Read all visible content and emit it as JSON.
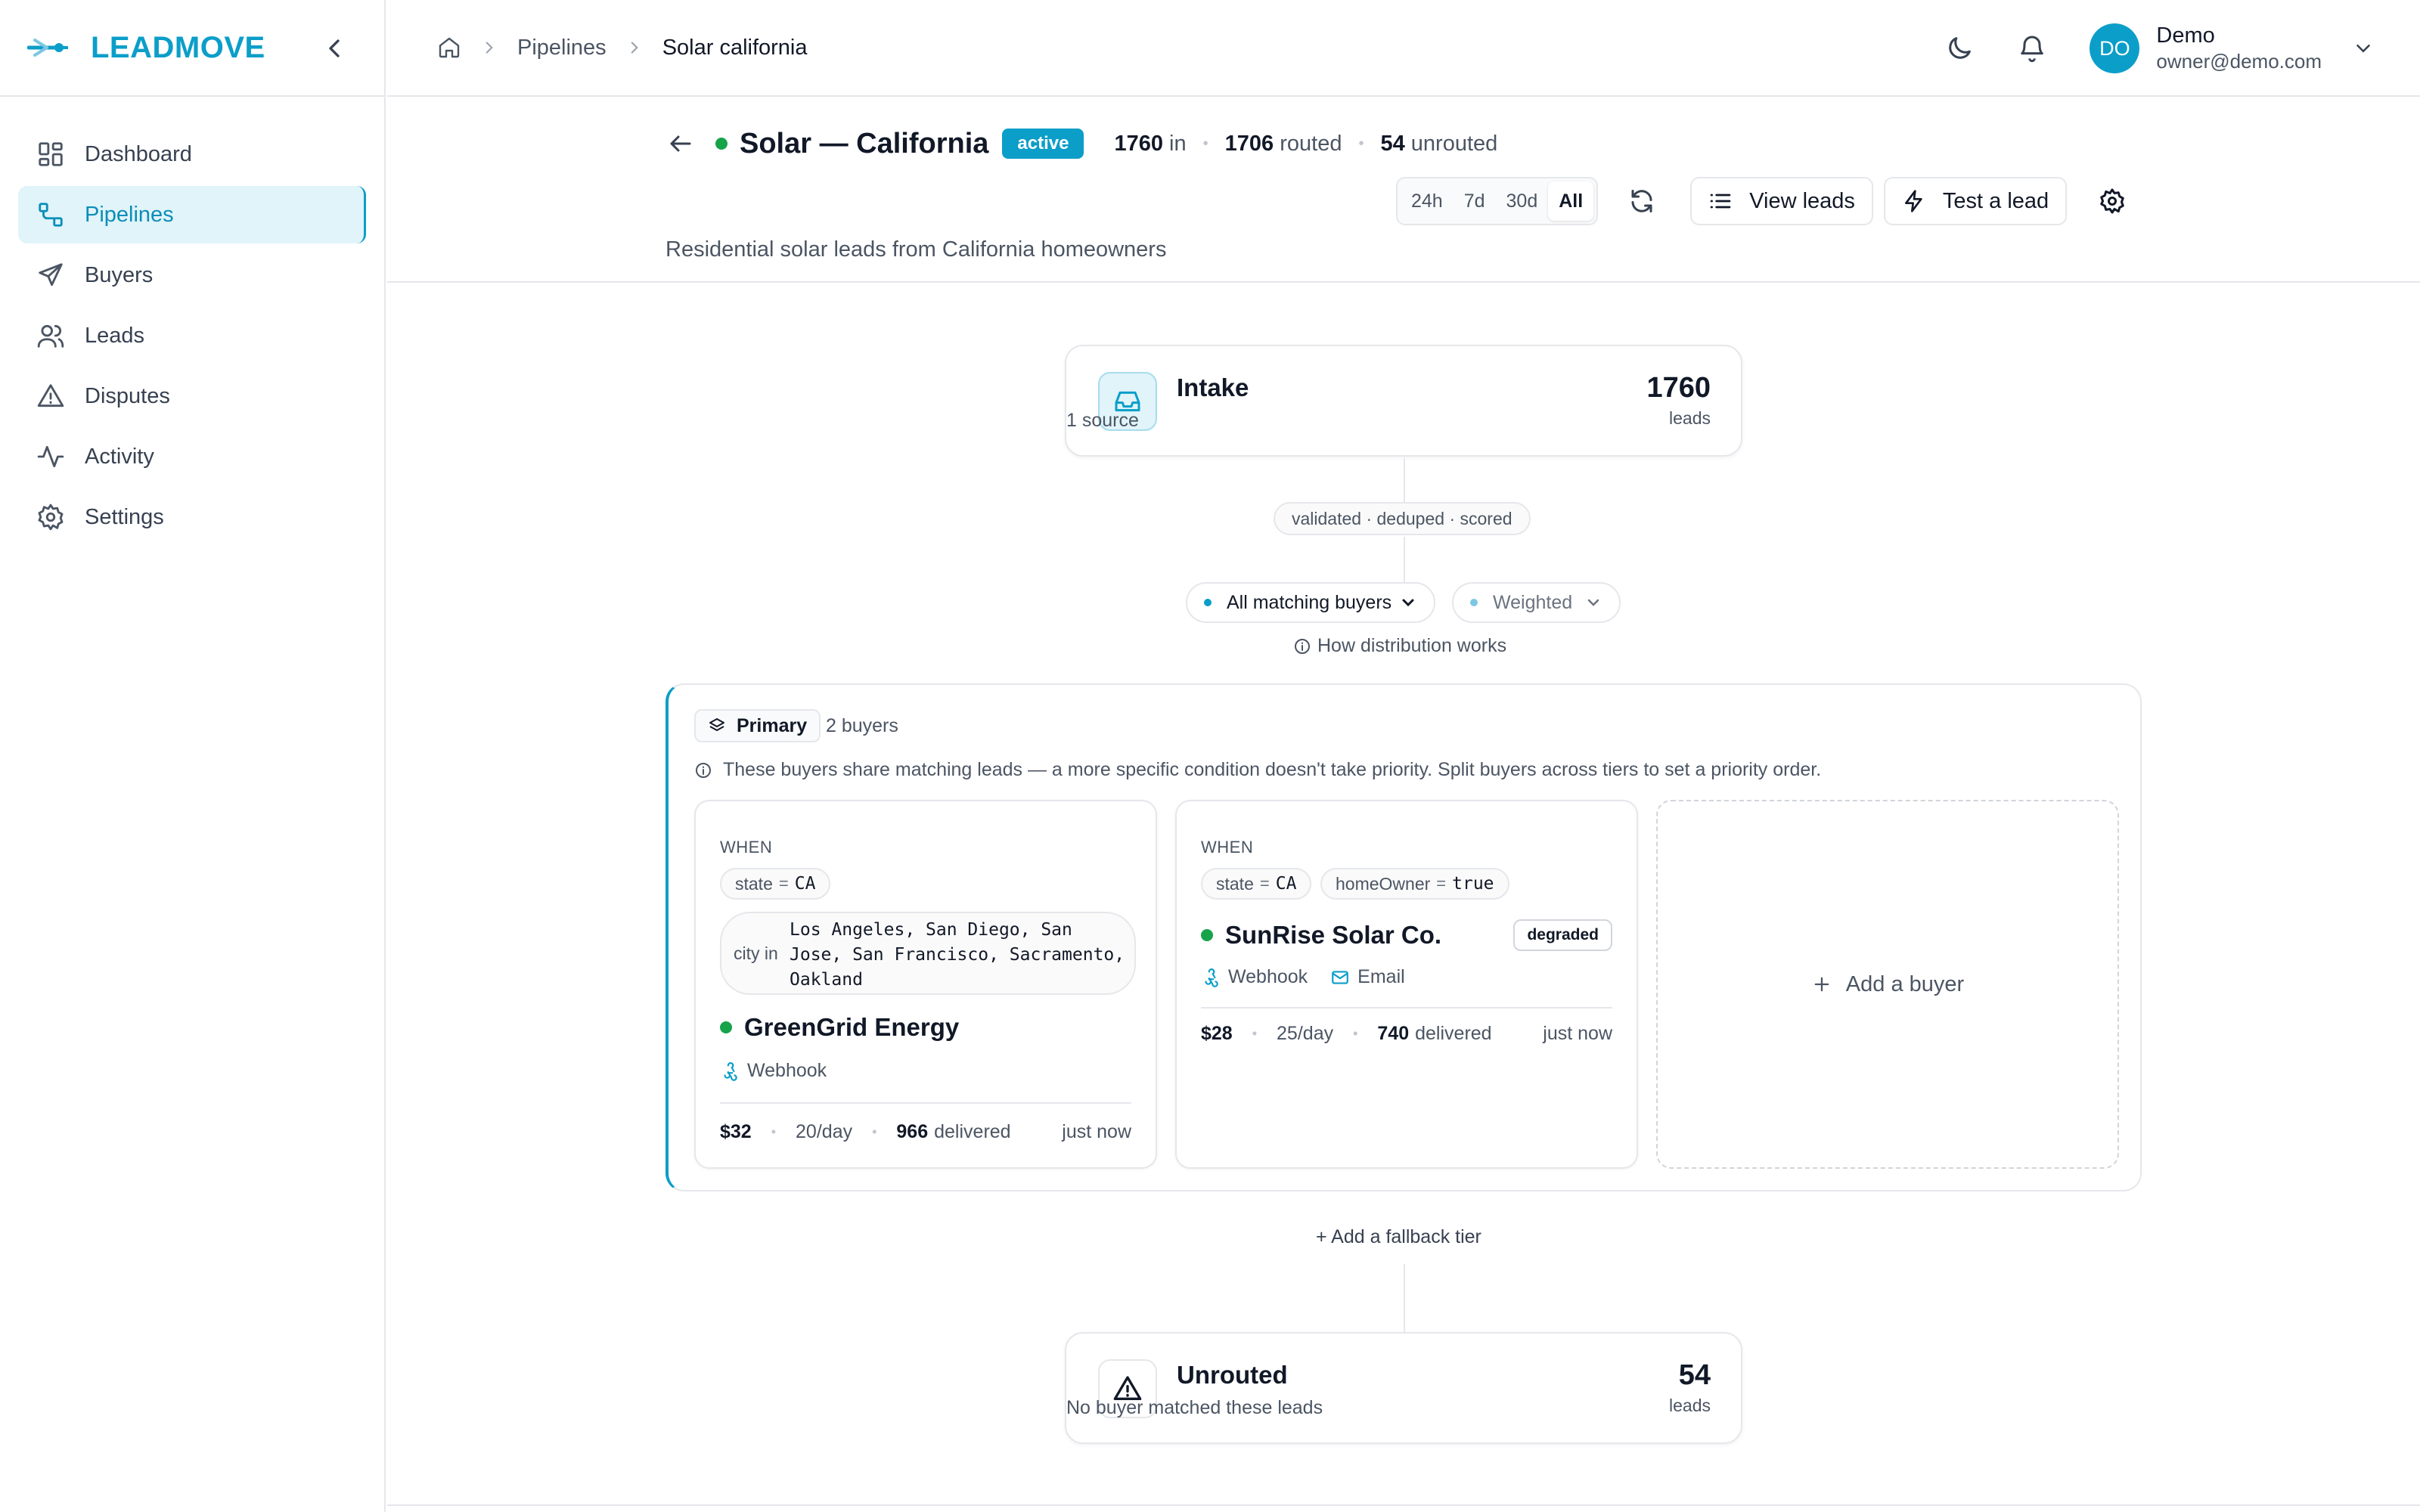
{
  "brand": {
    "name": "LEADMOVE"
  },
  "sidebar": {
    "items": [
      {
        "label": "Dashboard"
      },
      {
        "label": "Pipelines"
      },
      {
        "label": "Buyers"
      },
      {
        "label": "Leads"
      },
      {
        "label": "Disputes"
      },
      {
        "label": "Activity"
      },
      {
        "label": "Settings"
      }
    ]
  },
  "breadcrumb": {
    "level1": "Pipelines",
    "current": "Solar california"
  },
  "user": {
    "initials": "DO",
    "name": "Demo",
    "email": "owner@demo.com"
  },
  "pipeline": {
    "title": "Solar — California",
    "status": "active",
    "in_count": "1760",
    "in_label": "in",
    "routed_count": "1706",
    "routed_label": "routed",
    "unrouted_count": "54",
    "unrouted_label": "unrouted",
    "description": "Residential solar leads from California homeowners"
  },
  "toolbar": {
    "ranges": [
      "24h",
      "7d",
      "30d",
      "All"
    ],
    "selected_range": "All",
    "view_leads": "View leads",
    "test_lead": "Test a lead"
  },
  "intake": {
    "title": "Intake",
    "subtitle": "1 source",
    "count": "1760",
    "unit": "leads"
  },
  "checks": "validated · deduped · scored",
  "distribution": {
    "mode": "All matching buyers",
    "method": "Weighted",
    "help": "How distribution works"
  },
  "tier": {
    "name": "Primary",
    "count": "2 buyers",
    "note": "These buyers share matching leads — a more specific condition doesn't take priority. Split buyers across tiers to set a priority order.",
    "buyers": [
      {
        "when": "WHEN",
        "cond_state_key": "state",
        "cond_state_op": "=",
        "cond_state_val": "CA",
        "cond_city_key": "city",
        "cond_city_op": "in",
        "cond_city_val": "Los Angeles, San Diego, San Jose, San Francisco, Sacramento, Oakland",
        "name": "GreenGrid Energy",
        "channel1": "Webhook",
        "price": "$32",
        "cap": "20/day",
        "delivered_count": "966",
        "delivered_label": "delivered",
        "last": "just now"
      },
      {
        "when": "WHEN",
        "cond_state_key": "state",
        "cond_state_op": "=",
        "cond_state_val": "CA",
        "cond_home_key": "homeOwner",
        "cond_home_op": "=",
        "cond_home_val": "true",
        "name": "SunRise Solar Co.",
        "health": "degraded",
        "channel1": "Webhook",
        "channel2": "Email",
        "price": "$28",
        "cap": "25/day",
        "delivered_count": "740",
        "delivered_label": "delivered",
        "last": "just now"
      }
    ],
    "add_buyer": "Add a buyer"
  },
  "fallback": "+ Add a fallback tier",
  "unrouted": {
    "title": "Unrouted",
    "subtitle": "No buyer matched these leads",
    "count": "54",
    "unit": "leads"
  },
  "colors": {
    "accent": "#0b9ec9",
    "active_dot": "#16a34a",
    "border": "#e5e7eb"
  }
}
